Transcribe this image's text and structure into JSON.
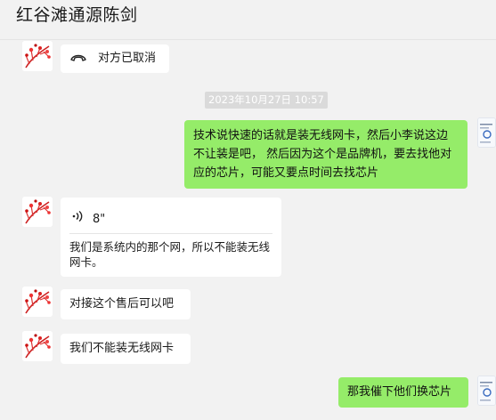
{
  "header": {
    "title": "红谷滩通源陈剑"
  },
  "messages": {
    "call": {
      "text": "对方已取消"
    },
    "timestamp": "2023年10月27日 10:57",
    "msg1": {
      "text": "技术说快速的话就是装无线网卡，然后小李说这边不让装是吧， 然后因为这个是品牌机，要去找他对应的芯片，可能又要点时间去找芯片"
    },
    "voice": {
      "duration": "8\"",
      "transcript": "我们是系统内的那个网，所以不能装无线网卡。"
    },
    "msg2": {
      "text": "对接这个售后可以吧"
    },
    "msg3": {
      "text": "我们不能装无线网卡"
    },
    "msg4": {
      "text": "那我催下他们换芯片"
    }
  },
  "icons": {
    "call": "phone-hangup-icon",
    "voice": "voice-wave-icon"
  },
  "colors": {
    "background": "#f2f2f2",
    "bubble_self": "#95ec69",
    "bubble_other": "#ffffff",
    "timestamp_bg": "#dadada"
  }
}
